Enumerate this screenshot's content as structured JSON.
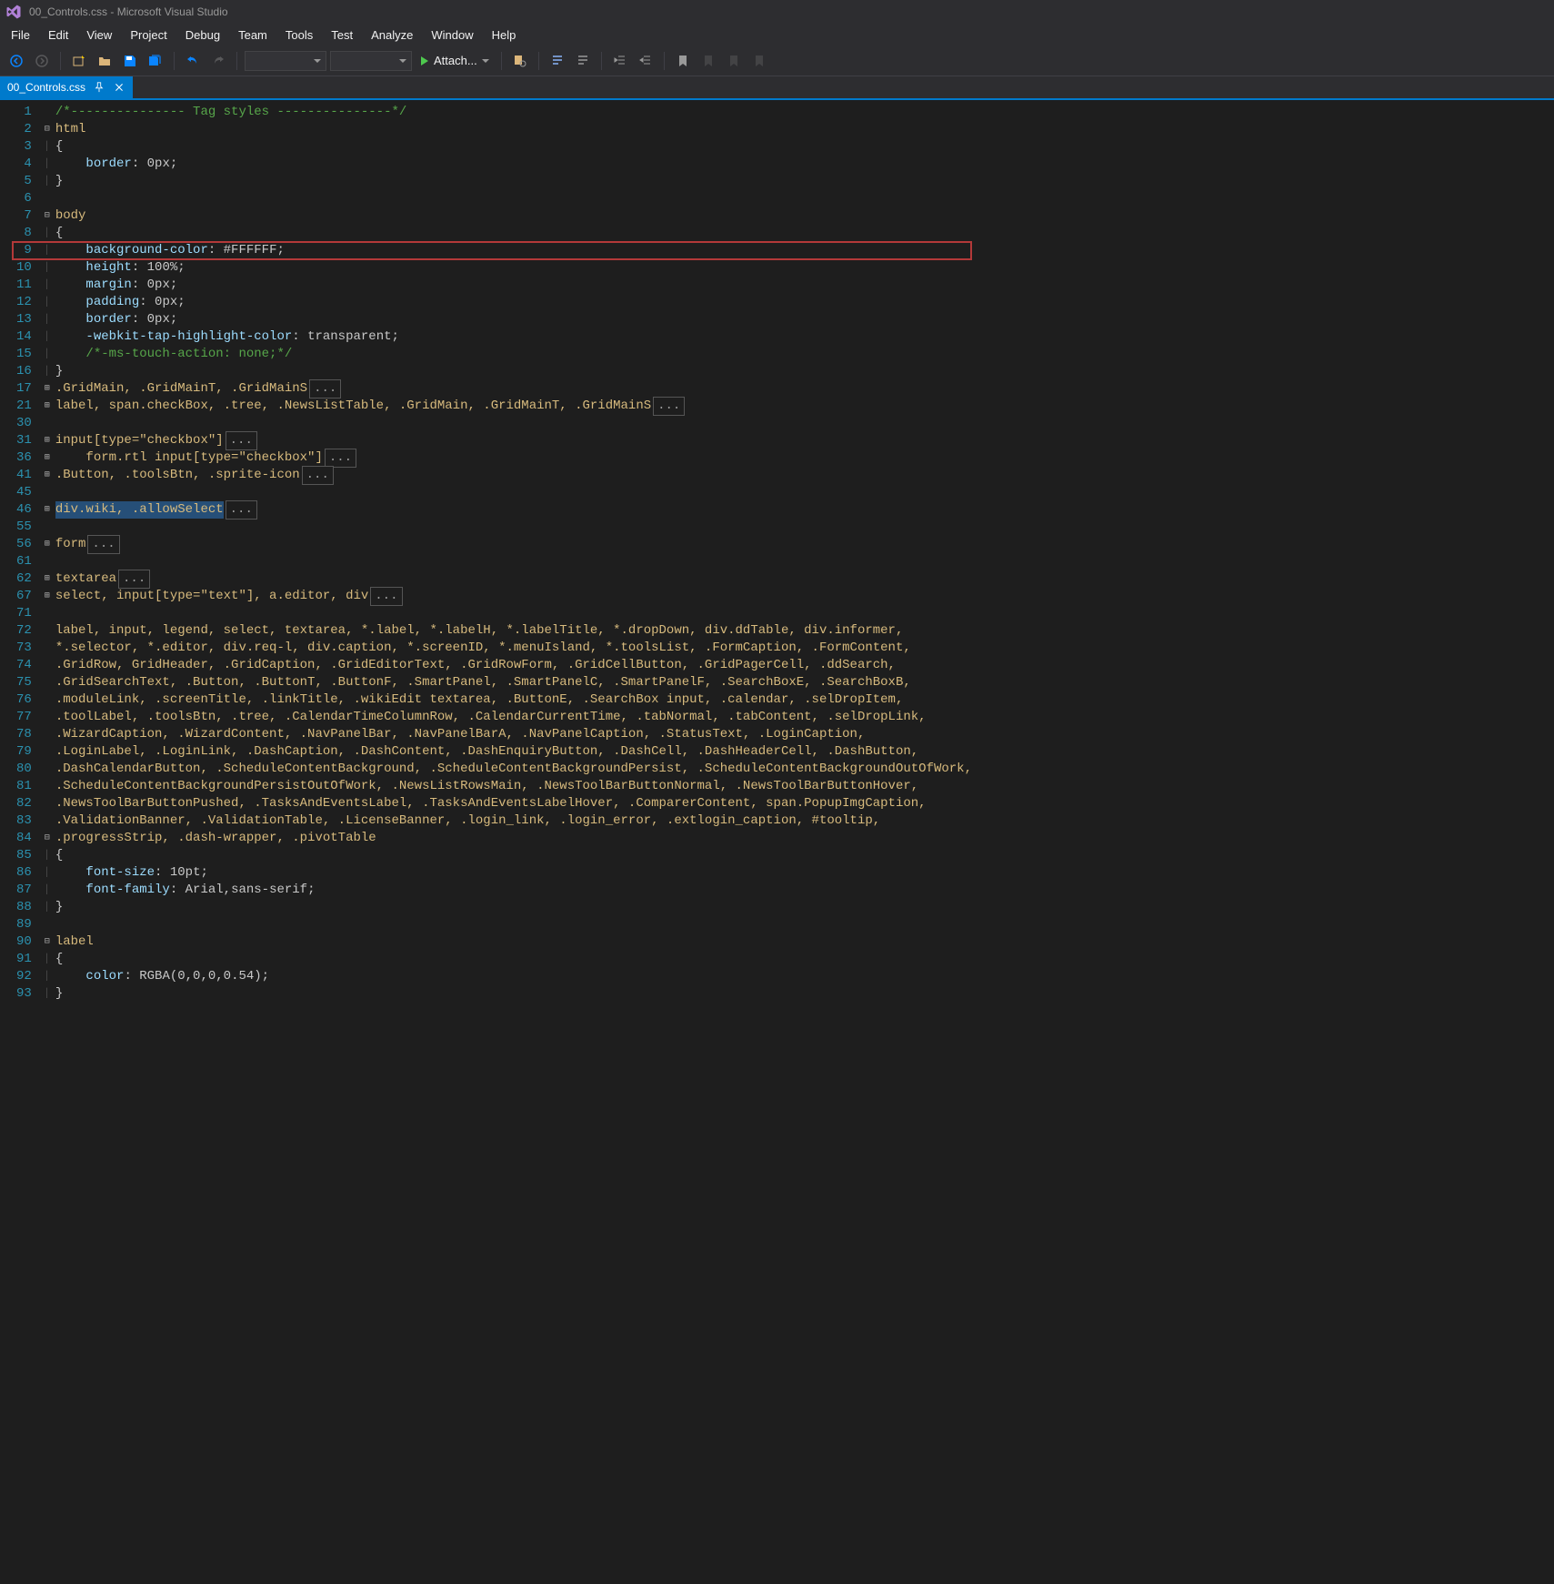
{
  "titlebar": {
    "title": "00_Controls.css - Microsoft Visual Studio"
  },
  "menu": [
    "File",
    "Edit",
    "View",
    "Project",
    "Debug",
    "Team",
    "Tools",
    "Test",
    "Analyze",
    "Window",
    "Help"
  ],
  "toolbar": {
    "attach_label": "Attach..."
  },
  "tab": {
    "name": "00_Controls.css"
  },
  "code": {
    "lines": [
      {
        "n": 1,
        "fold": "",
        "tokens": [
          {
            "c": "cm",
            "t": "/*--------------- Tag styles ---------------*/"
          }
        ]
      },
      {
        "n": 2,
        "fold": "minus",
        "tokens": [
          {
            "c": "sel",
            "t": "html"
          }
        ]
      },
      {
        "n": 3,
        "fold": "bar",
        "tokens": [
          {
            "c": "br",
            "t": "{"
          }
        ]
      },
      {
        "n": 4,
        "fold": "bar",
        "tokens": [
          {
            "c": "",
            "t": "    "
          },
          {
            "c": "prop",
            "t": "border"
          },
          {
            "c": "br",
            "t": ": "
          },
          {
            "c": "val",
            "t": "0px"
          },
          {
            "c": "br",
            "t": ";"
          }
        ]
      },
      {
        "n": 5,
        "fold": "bar",
        "tokens": [
          {
            "c": "br",
            "t": "}"
          }
        ]
      },
      {
        "n": 6,
        "fold": "",
        "tokens": []
      },
      {
        "n": 7,
        "fold": "minus",
        "tokens": [
          {
            "c": "sel",
            "t": "body"
          }
        ]
      },
      {
        "n": 8,
        "fold": "bar",
        "tokens": [
          {
            "c": "br",
            "t": "{"
          }
        ]
      },
      {
        "n": 9,
        "fold": "bar",
        "hl": true,
        "tokens": [
          {
            "c": "",
            "t": "    "
          },
          {
            "c": "prop",
            "t": "background-color"
          },
          {
            "c": "br",
            "t": ": "
          },
          {
            "c": "val",
            "t": "#FFFFFF"
          },
          {
            "c": "br",
            "t": ";"
          }
        ]
      },
      {
        "n": 10,
        "fold": "bar",
        "tokens": [
          {
            "c": "",
            "t": "    "
          },
          {
            "c": "prop",
            "t": "height"
          },
          {
            "c": "br",
            "t": ": "
          },
          {
            "c": "val",
            "t": "100%"
          },
          {
            "c": "br",
            "t": ";"
          }
        ]
      },
      {
        "n": 11,
        "fold": "bar",
        "tokens": [
          {
            "c": "",
            "t": "    "
          },
          {
            "c": "prop",
            "t": "margin"
          },
          {
            "c": "br",
            "t": ": "
          },
          {
            "c": "val",
            "t": "0px"
          },
          {
            "c": "br",
            "t": ";"
          }
        ]
      },
      {
        "n": 12,
        "fold": "bar",
        "tokens": [
          {
            "c": "",
            "t": "    "
          },
          {
            "c": "prop",
            "t": "padding"
          },
          {
            "c": "br",
            "t": ": "
          },
          {
            "c": "val",
            "t": "0px"
          },
          {
            "c": "br",
            "t": ";"
          }
        ]
      },
      {
        "n": 13,
        "fold": "bar",
        "tokens": [
          {
            "c": "",
            "t": "    "
          },
          {
            "c": "prop",
            "t": "border"
          },
          {
            "c": "br",
            "t": ": "
          },
          {
            "c": "val",
            "t": "0px"
          },
          {
            "c": "br",
            "t": ";"
          }
        ]
      },
      {
        "n": 14,
        "fold": "bar",
        "tokens": [
          {
            "c": "",
            "t": "    "
          },
          {
            "c": "prop",
            "t": "-webkit-tap-highlight-color"
          },
          {
            "c": "br",
            "t": ": "
          },
          {
            "c": "val",
            "t": "transparent"
          },
          {
            "c": "br",
            "t": ";"
          }
        ]
      },
      {
        "n": 15,
        "fold": "bar",
        "tokens": [
          {
            "c": "",
            "t": "    "
          },
          {
            "c": "cm",
            "t": "/*-ms-touch-action: none;*/"
          }
        ]
      },
      {
        "n": 16,
        "fold": "bar",
        "tokens": [
          {
            "c": "br",
            "t": "}"
          }
        ]
      },
      {
        "n": 17,
        "fold": "plus",
        "tokens": [
          {
            "c": "sel",
            "t": ".GridMain, .GridMainT, .GridMainS"
          }
        ],
        "collapsed": "..."
      },
      {
        "n": 21,
        "fold": "plus",
        "tokens": [
          {
            "c": "sel",
            "t": "label, span.checkBox, .tree, .NewsListTable, .GridMain, .GridMainT, .GridMainS"
          }
        ],
        "collapsed": "..."
      },
      {
        "n": 30,
        "fold": "",
        "tokens": []
      },
      {
        "n": 31,
        "fold": "plus",
        "tokens": [
          {
            "c": "sel",
            "t": "input[type=\"checkbox\"]"
          }
        ],
        "collapsed": "..."
      },
      {
        "n": 36,
        "fold": "plus",
        "tokens": [
          {
            "c": "sel",
            "t": "    form.rtl input[type=\"checkbox\"]"
          }
        ],
        "collapsed": "..."
      },
      {
        "n": 41,
        "fold": "plus",
        "tokens": [
          {
            "c": "sel",
            "t": ".Button, .toolsBtn, .sprite-icon"
          }
        ],
        "collapsed": "..."
      },
      {
        "n": 45,
        "fold": "",
        "tokens": []
      },
      {
        "n": 46,
        "fold": "plus",
        "tokens": [
          {
            "c": "highlighted-sel",
            "t": "div.wiki, .allowSelect"
          }
        ],
        "collapsed": "..."
      },
      {
        "n": 55,
        "fold": "",
        "tokens": []
      },
      {
        "n": 56,
        "fold": "plus",
        "tokens": [
          {
            "c": "sel",
            "t": "form"
          }
        ],
        "collapsed": "..."
      },
      {
        "n": 61,
        "fold": "",
        "tokens": []
      },
      {
        "n": 62,
        "fold": "plus",
        "tokens": [
          {
            "c": "sel",
            "t": "textarea"
          }
        ],
        "collapsed": "..."
      },
      {
        "n": 67,
        "fold": "plus",
        "tokens": [
          {
            "c": "sel",
            "t": "select, input[type=\"text\"], a.editor, div"
          }
        ],
        "collapsed": "..."
      },
      {
        "n": 71,
        "fold": "",
        "tokens": []
      },
      {
        "n": 72,
        "fold": "",
        "tokens": [
          {
            "c": "sel",
            "t": "label, input, legend, select, textarea, *.label, *.labelH, *.labelTitle, *.dropDown, div.ddTable, div.informer,"
          }
        ]
      },
      {
        "n": 73,
        "fold": "",
        "tokens": [
          {
            "c": "sel",
            "t": "*.selector, *.editor, div.req-l, div.caption, *.screenID, *.menuIsland, *.toolsList, .FormCaption, .FormContent,"
          }
        ]
      },
      {
        "n": 74,
        "fold": "",
        "tokens": [
          {
            "c": "sel",
            "t": ".GridRow, GridHeader, .GridCaption, .GridEditorText, .GridRowForm, .GridCellButton, .GridPagerCell, .ddSearch,"
          }
        ]
      },
      {
        "n": 75,
        "fold": "",
        "tokens": [
          {
            "c": "sel",
            "t": ".GridSearchText, .Button, .ButtonT, .ButtonF, .SmartPanel, .SmartPanelC, .SmartPanelF, .SearchBoxE, .SearchBoxB,"
          }
        ]
      },
      {
        "n": 76,
        "fold": "",
        "tokens": [
          {
            "c": "sel",
            "t": ".moduleLink, .screenTitle, .linkTitle, .wikiEdit textarea, .ButtonE, .SearchBox input, .calendar, .selDropItem,"
          }
        ]
      },
      {
        "n": 77,
        "fold": "",
        "tokens": [
          {
            "c": "sel",
            "t": ".toolLabel, .toolsBtn, .tree, .CalendarTimeColumnRow, .CalendarCurrentTime, .tabNormal, .tabContent, .selDropLink,"
          }
        ]
      },
      {
        "n": 78,
        "fold": "",
        "tokens": [
          {
            "c": "sel",
            "t": ".WizardCaption, .WizardContent, .NavPanelBar, .NavPanelBarA, .NavPanelCaption, .StatusText, .LoginCaption,"
          }
        ]
      },
      {
        "n": 79,
        "fold": "",
        "tokens": [
          {
            "c": "sel",
            "t": ".LoginLabel, .LoginLink, .DashCaption, .DashContent, .DashEnquiryButton, .DashCell, .DashHeaderCell, .DashButton,"
          }
        ]
      },
      {
        "n": 80,
        "fold": "",
        "tokens": [
          {
            "c": "sel",
            "t": ".DashCalendarButton, .ScheduleContentBackground, .ScheduleContentBackgroundPersist, .ScheduleContentBackgroundOutOfWork,"
          }
        ]
      },
      {
        "n": 81,
        "fold": "",
        "tokens": [
          {
            "c": "sel",
            "t": ".ScheduleContentBackgroundPersistOutOfWork, .NewsListRowsMain, .NewsToolBarButtonNormal, .NewsToolBarButtonHover,"
          }
        ]
      },
      {
        "n": 82,
        "fold": "",
        "tokens": [
          {
            "c": "sel",
            "t": ".NewsToolBarButtonPushed, .TasksAndEventsLabel, .TasksAndEventsLabelHover, .ComparerContent, span.PopupImgCaption,"
          }
        ]
      },
      {
        "n": 83,
        "fold": "",
        "tokens": [
          {
            "c": "sel",
            "t": ".ValidationBanner, .ValidationTable, .LicenseBanner, .login_link, .login_error, .extlogin_caption, #tooltip,"
          }
        ]
      },
      {
        "n": 84,
        "fold": "minus",
        "tokens": [
          {
            "c": "sel",
            "t": ".progressStrip, .dash-wrapper, .pivotTable"
          }
        ]
      },
      {
        "n": 85,
        "fold": "bar",
        "tokens": [
          {
            "c": "br",
            "t": "{"
          }
        ]
      },
      {
        "n": 86,
        "fold": "bar",
        "tokens": [
          {
            "c": "",
            "t": "    "
          },
          {
            "c": "prop",
            "t": "font-size"
          },
          {
            "c": "br",
            "t": ": "
          },
          {
            "c": "val",
            "t": "10pt"
          },
          {
            "c": "br",
            "t": ";"
          }
        ]
      },
      {
        "n": 87,
        "fold": "bar",
        "tokens": [
          {
            "c": "",
            "t": "    "
          },
          {
            "c": "prop",
            "t": "font-family"
          },
          {
            "c": "br",
            "t": ": "
          },
          {
            "c": "val",
            "t": "Arial,sans-serif"
          },
          {
            "c": "br",
            "t": ";"
          }
        ]
      },
      {
        "n": 88,
        "fold": "bar",
        "tokens": [
          {
            "c": "br",
            "t": "}"
          }
        ]
      },
      {
        "n": 89,
        "fold": "",
        "tokens": []
      },
      {
        "n": 90,
        "fold": "minus",
        "tokens": [
          {
            "c": "sel",
            "t": "label"
          }
        ]
      },
      {
        "n": 91,
        "fold": "bar",
        "tokens": [
          {
            "c": "br",
            "t": "{"
          }
        ]
      },
      {
        "n": 92,
        "fold": "bar",
        "tokens": [
          {
            "c": "",
            "t": "    "
          },
          {
            "c": "prop",
            "t": "color"
          },
          {
            "c": "br",
            "t": ": "
          },
          {
            "c": "fn",
            "t": "RGBA(0,0,0,0.54)"
          },
          {
            "c": "br",
            "t": ";"
          }
        ]
      },
      {
        "n": 93,
        "fold": "bar",
        "tokens": [
          {
            "c": "br",
            "t": "}"
          }
        ]
      }
    ]
  }
}
